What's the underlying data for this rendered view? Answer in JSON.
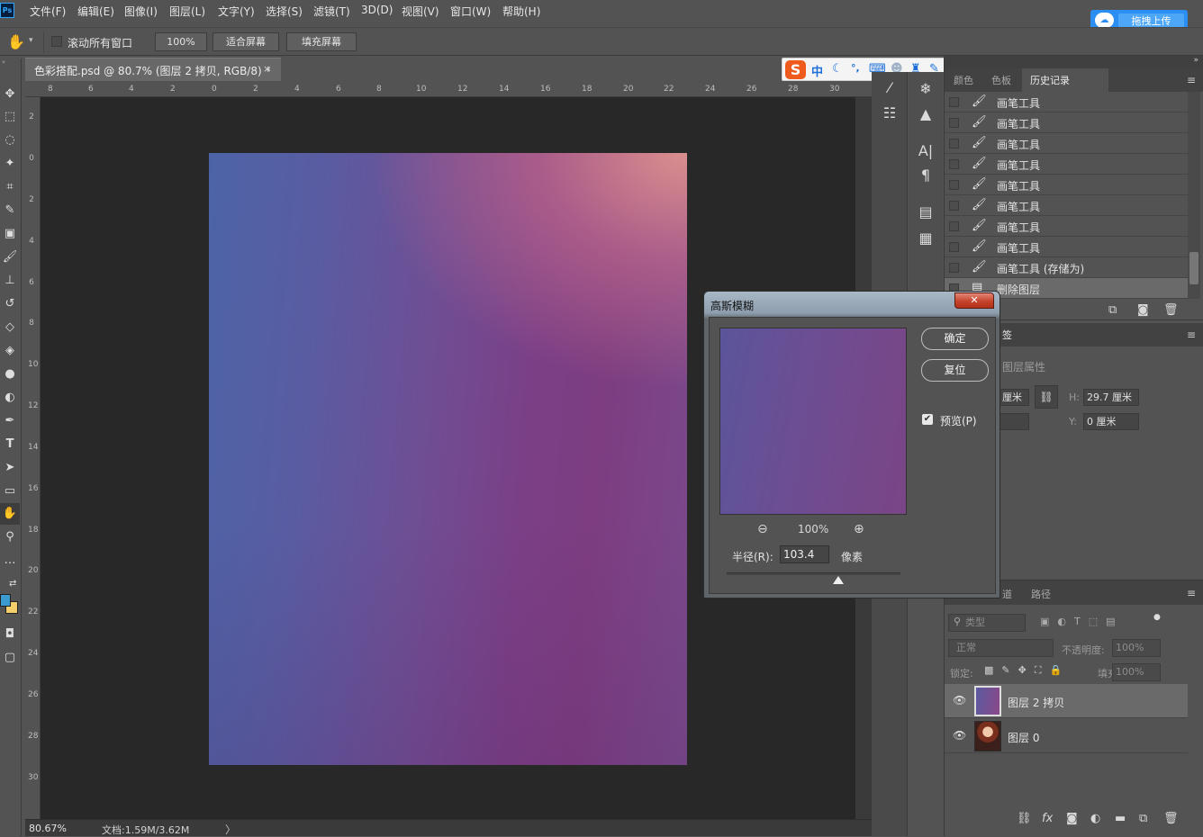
{
  "menubar": {
    "logo": "Ps",
    "items": [
      "文件(F)",
      "编辑(E)",
      "图像(I)",
      "图层(L)",
      "文字(Y)",
      "选择(S)",
      "滤镜(T)",
      "3D(D)",
      "视图(V)",
      "窗口(W)",
      "帮助(H)"
    ],
    "upload_button": "拖拽上传"
  },
  "options": {
    "scroll_all_label": "滚动所有窗口",
    "zoom_value": "100%",
    "fit_screen": "适合屏幕",
    "fill_screen": "填充屏幕"
  },
  "document": {
    "tab_title": "色彩搭配.psd @ 80.7% (图层 2 拷贝, RGB/8) *",
    "close": "×",
    "zoom_status": "80.67%",
    "doc_status": "文档:1.59M/3.62M",
    "status_arrow": "〉"
  },
  "ruler_top": [
    "8",
    "6",
    "4",
    "2",
    "0",
    "2",
    "4",
    "6",
    "8",
    "10",
    "12",
    "14",
    "16",
    "18",
    "20",
    "22",
    "24",
    "26",
    "28",
    "30"
  ],
  "ruler_left": [
    "2",
    "0",
    "2",
    "4",
    "6",
    "8",
    "10",
    "12",
    "14",
    "16",
    "18",
    "20",
    "22",
    "24",
    "26",
    "28",
    "30"
  ],
  "ime": {
    "logo": "S",
    "lang": "中"
  },
  "history": {
    "tabs": [
      "颜色",
      "色板",
      "历史记录"
    ],
    "items": [
      "画笔工具",
      "画笔工具",
      "画笔工具",
      "画笔工具",
      "画笔工具",
      "画笔工具",
      "画笔工具",
      "画笔工具",
      "画笔工具 (存储为)",
      "删除图层"
    ]
  },
  "properties": {
    "tab_partial": "签",
    "title": "图层属性",
    "w_value": "厘米",
    "h_label": "H:",
    "h_value": "29.7 厘米",
    "y_label": "Y:",
    "y_value": "0 厘米"
  },
  "layers": {
    "tabs": [
      "道",
      "路径"
    ],
    "filter": "类型",
    "blend_mode": "正常",
    "opacity_label": "不透明度:",
    "opacity_value": "100%",
    "lock_label": "锁定:",
    "fill_label": "填充:",
    "fill_value": "100%",
    "items": [
      {
        "name": "图层 2 拷贝",
        "selected": true
      },
      {
        "name": "图层 0",
        "selected": false
      }
    ]
  },
  "dialog": {
    "title": "高斯模糊",
    "close": "✕",
    "ok": "确定",
    "reset": "复位",
    "preview_label": "预览(P)",
    "preview_checked": true,
    "zoom": "100%",
    "radius_label": "半径(R):",
    "radius_value": "103.4",
    "radius_unit": "像素"
  },
  "colors": {
    "foreground": "#3d9ad1",
    "background": "#f4cf6c",
    "upload_blue": "#2a8ef2",
    "ime_orange": "#ef5a1d"
  }
}
